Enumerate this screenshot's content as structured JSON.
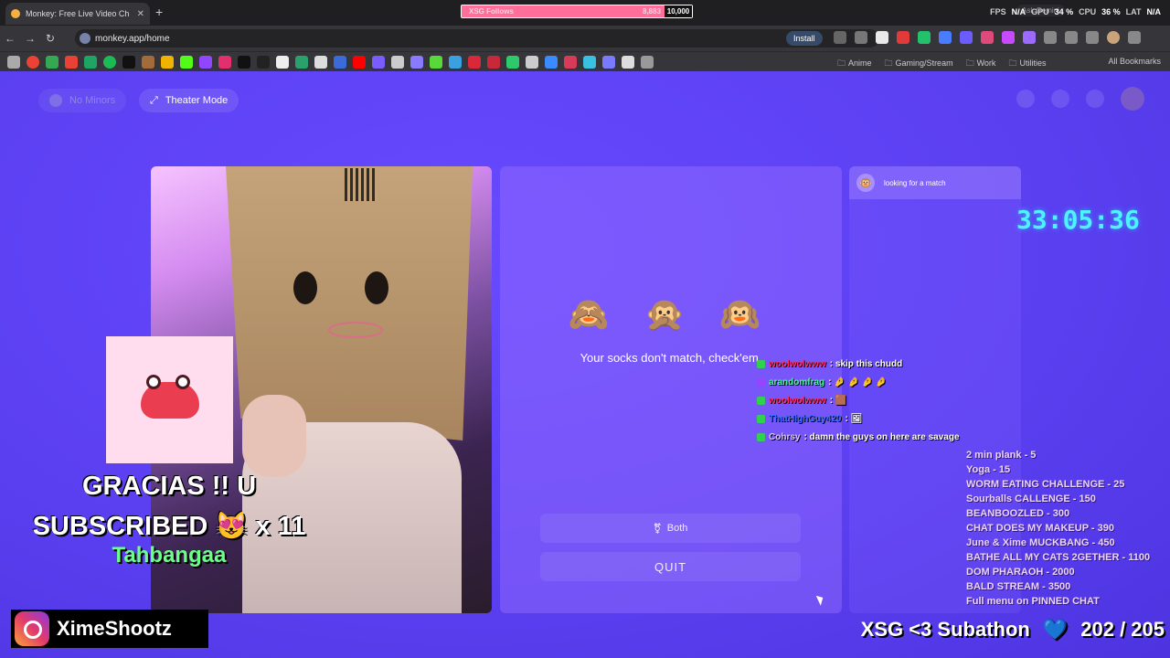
{
  "browser": {
    "tab_title": "Monkey: Free Live Video Ch",
    "url": "monkey.app/home",
    "install_label": "Install",
    "follow_label": "XSG Follows",
    "follow_current": "8,883",
    "follow_goal": "10,000",
    "gemini_label": "Ask Gemini",
    "stats": {
      "fps_label": "FPS",
      "fps": "N/A",
      "gpu_label": "GPU",
      "gpu": "34 %",
      "cpu_label": "CPU",
      "cpu": "36 %",
      "lat_label": "LAT",
      "lat": "N/A"
    },
    "bookmark_folders": [
      "Anime",
      "Gaming/Stream",
      "Work",
      "Utilities"
    ],
    "all_bookmarks": "All Bookmarks"
  },
  "page": {
    "no_minors": "No Minors",
    "theater_mode": "Theater Mode",
    "monkey_emojis": "🙈 🙊 🙉",
    "tagline": "Your socks don't match, check'em.",
    "both_label": "Both",
    "quit_label": "QUIT",
    "match_status": "looking for a match"
  },
  "overlay": {
    "timer": "33:05:36",
    "alert_line1": "GRACIAS !! U",
    "alert_line2": "SUBSCRIBED 😻 x 11",
    "alert_name": "Tahbangaa",
    "instagram": "XimeShootz",
    "subathon_label": "XSG <3 Subathon",
    "subathon_count": "202 / 205"
  },
  "chat": [
    {
      "user": "woolwolwww",
      "text": ": skip this chudd"
    },
    {
      "user": "arandomfrag",
      "text": ": 🤌 🤌 🤌 🤌"
    },
    {
      "user": "woolwolwww",
      "text": ": 🟫"
    },
    {
      "user": "ThatHighGuy420",
      "text": ": 🖼"
    },
    {
      "user": "Cohrsy",
      "text": ": damn the guys on here are savage"
    }
  ],
  "menu": [
    "2 min plank - 5",
    "Yoga - 15",
    "WORM EATING CHALLENGE - 25",
    "Sourballs CALLENGE - 150",
    "BEANBOOZLED - 300",
    "CHAT DOES MY MAKEUP - 390",
    "June & Xime MUCKBANG - 450",
    "BATHE ALL MY CATS 2GETHER - 1100",
    "DOM PHARAOH - 2000",
    "BALD STREAM - 3500",
    "Full menu on PINNED CHAT"
  ],
  "colors": {
    "page_bg": "#5a3ff0",
    "timer": "#4ff2ff",
    "alert_name": "#6bff8a",
    "follow_bar": "#ff6f9a"
  }
}
